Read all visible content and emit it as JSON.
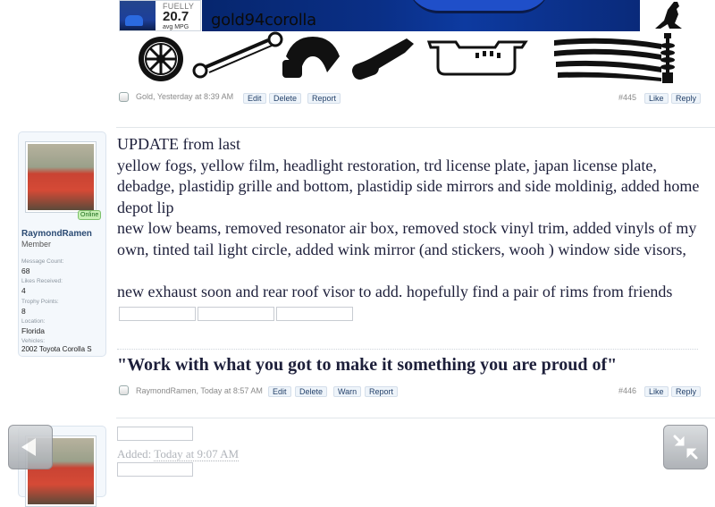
{
  "signature_banner": {
    "mpg_brand": "FUELLY",
    "mpg_value": "20.7",
    "mpg_unit": "avg MPG",
    "username": "gold94corolla"
  },
  "post_445": {
    "author": "Gold",
    "time": "Yesterday at 8:39 AM",
    "buttons": [
      "Edit",
      "Delete",
      "Report"
    ],
    "number": "#445",
    "like": "Like",
    "reply": "Reply"
  },
  "user_card": {
    "online": "Online",
    "name": "RaymondRamen",
    "title": "Member",
    "stats": [
      {
        "label": "Message Count:",
        "value": "68"
      },
      {
        "label": "Likes Received:",
        "value": "4"
      },
      {
        "label": "Trophy Points:",
        "value": "8"
      },
      {
        "label": "Location:",
        "value": "Florida"
      },
      {
        "label": "Vehicles:",
        "value": "2002 Toyota Corolla S"
      }
    ]
  },
  "post_446": {
    "body": {
      "line1": "UPDATE from last",
      "line2": "yellow fogs, yellow film, headlight restoration, trd license plate, japan license plate, debadge, plastidip grille and bottom, plastidip side mirrors and side moldinig, added home depot lip",
      "line3": "new low beams, removed resonator air box, removed stock vinyl trim, added vinyls of my own, tinted tail light circle, added wink mirror (and stickers, wooh ) window side visors,",
      "line4": "new exhaust soon and rear roof visor to add. hopefully find a pair of rims from friends"
    },
    "signature": "\"Work with what you got to make it something you are proud of\"",
    "author": "RaymondRamen",
    "time": "Today at 8:57 AM",
    "buttons": [
      "Edit",
      "Delete",
      "Warn",
      "Report"
    ],
    "number": "#446",
    "like": "Like",
    "reply": "Reply"
  },
  "post_447": {
    "added_prefix": "Added:",
    "added_time": "Today at 9:07 AM"
  },
  "nav": {
    "back_icon": "back-arrow-icon",
    "collapse_icon": "collapse-arrows-icon"
  }
}
